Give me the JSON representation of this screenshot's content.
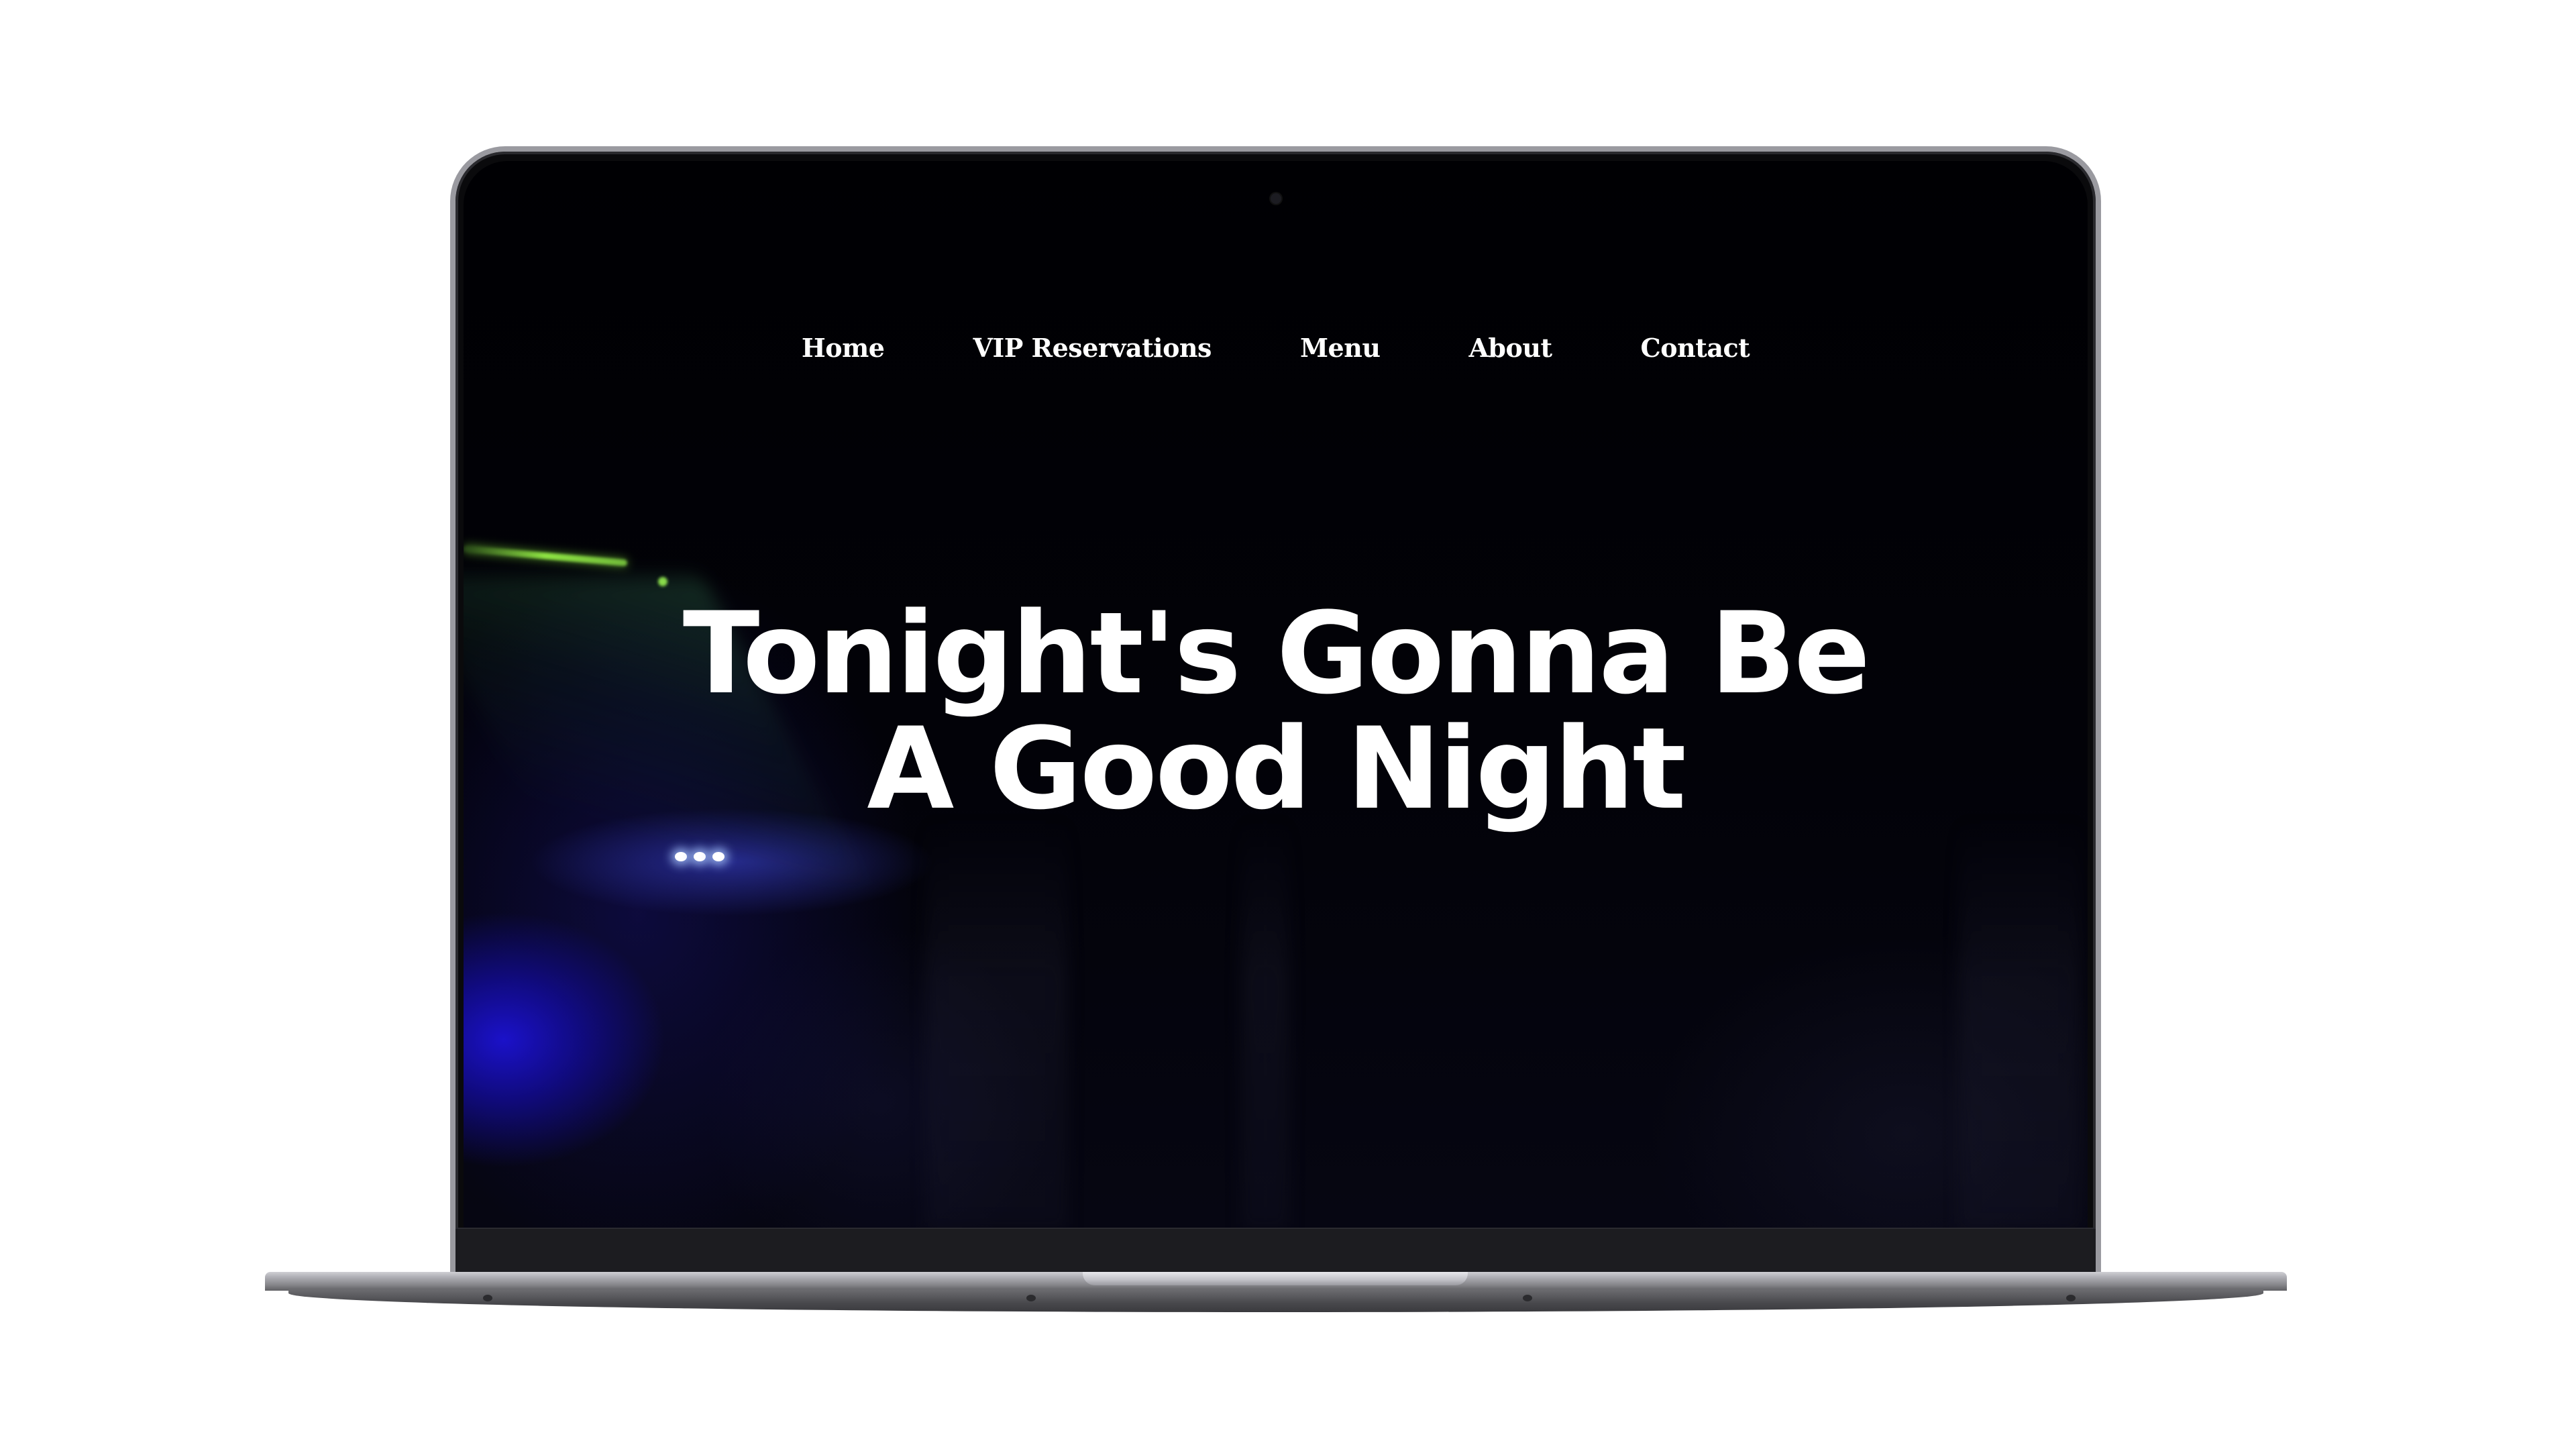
{
  "nav": {
    "items": [
      {
        "label": "Home"
      },
      {
        "label": "VIP Reservations"
      },
      {
        "label": "Menu"
      },
      {
        "label": "About"
      },
      {
        "label": "Contact"
      }
    ]
  },
  "hero": {
    "title_line1": "Tonight's Gonna Be",
    "title_line2": "A Good Night"
  },
  "colors": {
    "background": "#020205",
    "text": "#ffffff",
    "accent_blue": "#1c12d2",
    "laser_green": "#96f046",
    "device_frame": "#9a9aa0"
  },
  "icons": [
    "webcam-icon"
  ]
}
